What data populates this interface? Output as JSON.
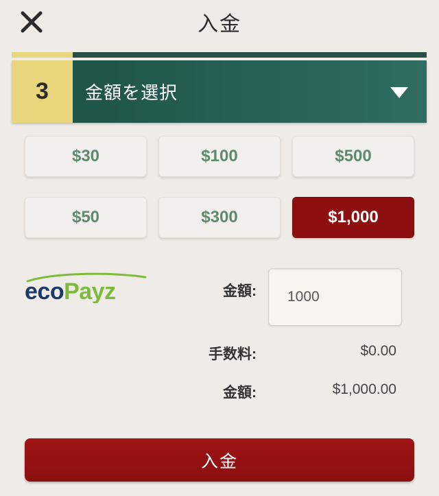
{
  "header": {
    "title": "入金"
  },
  "step": {
    "number": "3",
    "label": "金額を選択"
  },
  "amounts": [
    "$30",
    "$100",
    "$500",
    "$50",
    "$300",
    "$1,000"
  ],
  "selected_amount": "$1,000",
  "payment": {
    "provider_logo": "ecoPayz",
    "logo_eco": "eco",
    "logo_payz": "Payz"
  },
  "form": {
    "amount_label": "金額:",
    "amount_value": "1000",
    "fee_label": "手数料:",
    "fee_value": "$0.00",
    "total_label": "金額:",
    "total_value": "$1,000.00"
  },
  "deposit_button": "入金",
  "colors": {
    "background": "#efece7",
    "accent_green": "#264f46",
    "step_yellow": "#e8d57c",
    "amount_text": "#5e8a6c",
    "selected_red": "#8e0f0f"
  }
}
